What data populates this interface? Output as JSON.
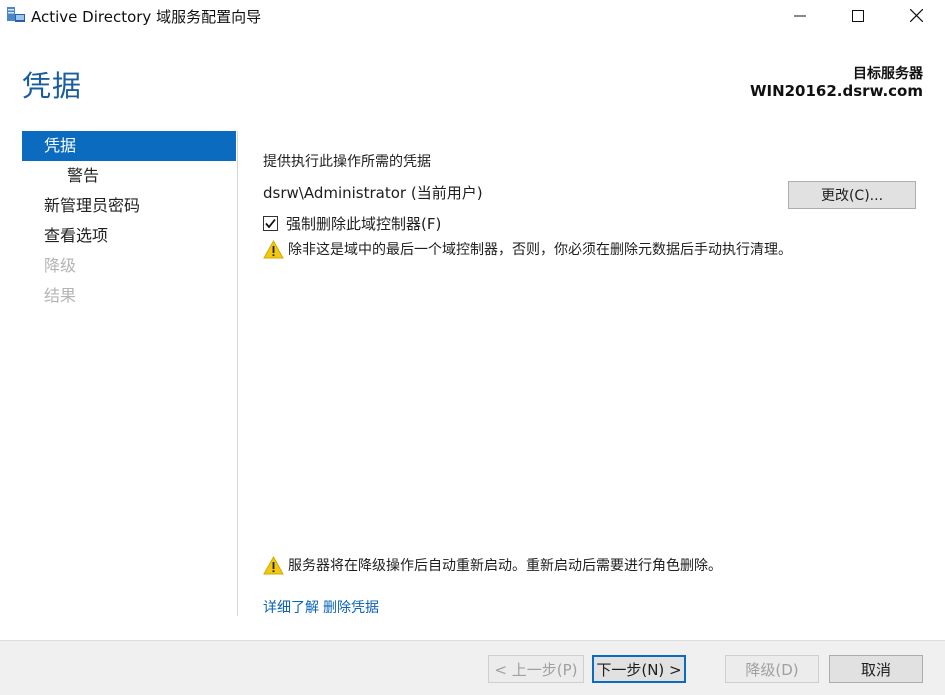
{
  "window": {
    "title": "Active Directory 域服务配置向导",
    "icon": "server-tool-icon",
    "controls": [
      "minimize-icon",
      "maximize-icon",
      "close-icon"
    ]
  },
  "header": {
    "page_title": "凭据",
    "target_label": "目标服务器",
    "target_name": "WIN20162.dsrw.com"
  },
  "nav": {
    "items": [
      {
        "label": "凭据",
        "state": "active"
      },
      {
        "label": "警告",
        "state": "sub"
      },
      {
        "label": "新管理员密码",
        "state": "normal"
      },
      {
        "label": "查看选项",
        "state": "normal"
      },
      {
        "label": "降级",
        "state": "disabled"
      },
      {
        "label": "结果",
        "state": "disabled"
      }
    ]
  },
  "main": {
    "heading": "提供执行此操作所需的凭据",
    "user": "dsrw\\Administrator (当前用户)",
    "change_button": "更改(C)...",
    "force_remove_label": "强制删除此域控制器(F)",
    "force_remove_checked": true,
    "warning_text": "除非这是域中的最后一个域控制器，否则，你必须在删除元数据后手动执行清理。",
    "restart_warning": "服务器将在降级操作后自动重新启动。重新启动后需要进行角色删除。",
    "learn_more_link": "详细了解",
    "remove_credentials_link": "删除凭据"
  },
  "footer": {
    "prev_button": "< 上一步(P)",
    "next_button": "下一步(N) >",
    "demote_button": "降级(D)",
    "cancel_button": "取消"
  },
  "colors": {
    "accent": "#0a6bbf",
    "title_blue": "#1a5d9f",
    "link": "#0a63b5",
    "warning_yellow": "#f2c811",
    "disabled_text": "#b4b4b4"
  }
}
